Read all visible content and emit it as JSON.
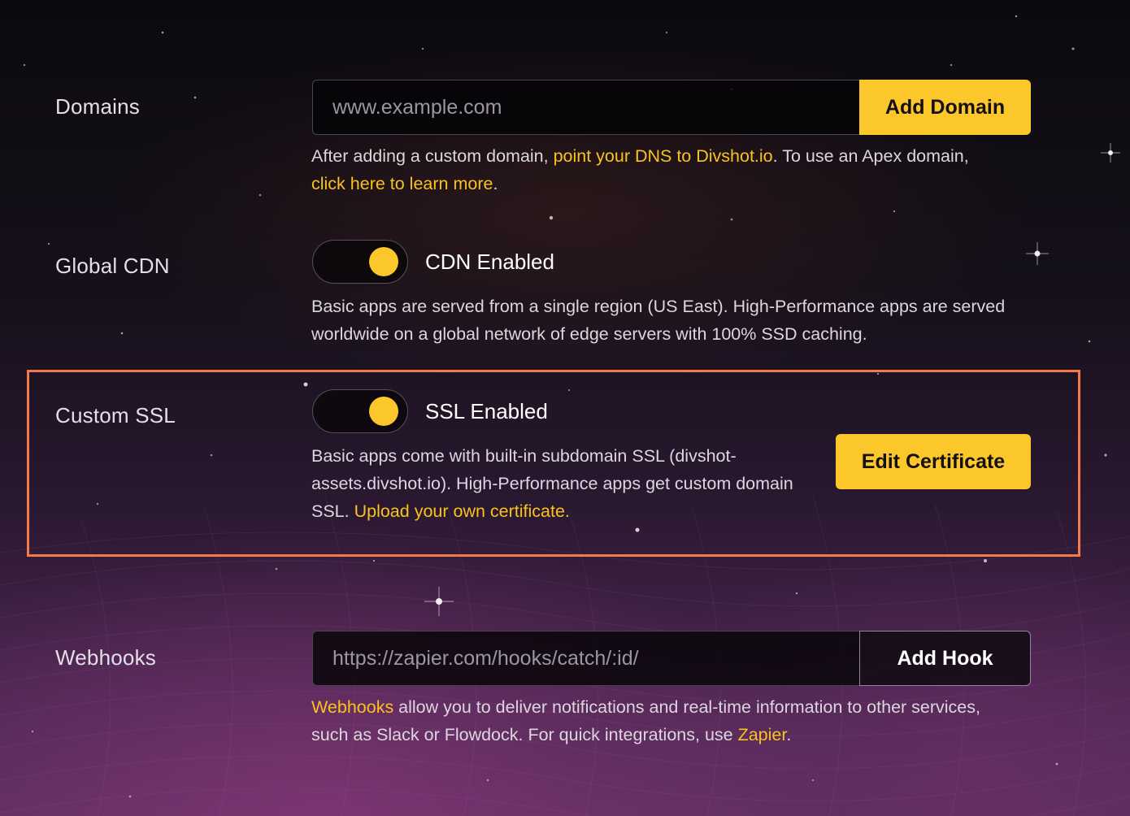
{
  "domains": {
    "label": "Domains",
    "input_placeholder": "www.example.com",
    "button": "Add Domain",
    "help_1": "After adding a custom domain, ",
    "help_link_1": "point your DNS to Divshot.io",
    "help_2": ". To use an Apex domain, ",
    "help_link_2": "click here to learn more",
    "help_3": "."
  },
  "cdn": {
    "label": "Global CDN",
    "toggle_label": "CDN Enabled",
    "toggle_on": true,
    "help": "Basic apps are served from a single region (US East). High-Performance apps are served worldwide on a global network of edge servers with 100% SSD caching."
  },
  "ssl": {
    "label": "Custom SSL",
    "toggle_label": "SSL Enabled",
    "toggle_on": true,
    "help_1": "Basic apps come with built-in subdomain SSL (divshot-assets.divshot.io). High-Performance apps get custom domain SSL. ",
    "help_link": "Upload your own certificate.",
    "button": "Edit Certificate",
    "highlight_color": "#f47a4c"
  },
  "webhooks": {
    "label": "Webhooks",
    "input_placeholder": "https://zapier.com/hooks/catch/:id/",
    "button": "Add Hook",
    "help_link_1": "Webhooks",
    "help_1": " allow you to deliver notifications and real-time information to other services, such as Slack or Flowdock. For quick integrations, use ",
    "help_link_2": "Zapier",
    "help_2": "."
  },
  "colors": {
    "accent": "#fcc72a",
    "link": "#f9c21e"
  }
}
